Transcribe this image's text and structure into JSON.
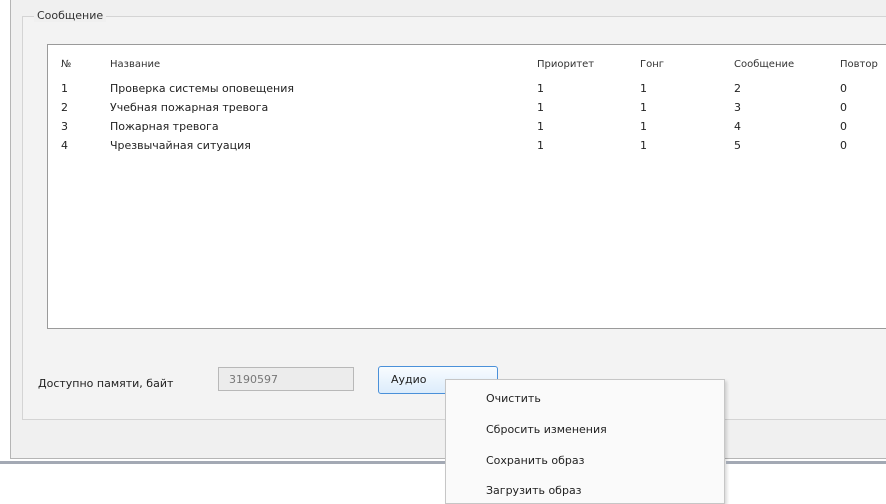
{
  "group": {
    "title": "Сообщение"
  },
  "table": {
    "headers": [
      "№",
      "Название",
      "Приоритет",
      "Гонг",
      "Сообщение",
      "Повтор"
    ],
    "rows": [
      [
        "1",
        "Проверка системы оповещения",
        "1",
        "1",
        "2",
        "0"
      ],
      [
        "2",
        "Учебная пожарная тревога",
        "1",
        "1",
        "3",
        "0"
      ],
      [
        "3",
        "Пожарная тревога",
        "1",
        "1",
        "4",
        "0"
      ],
      [
        "4",
        "Чрезвычайная ситуация",
        "1",
        "1",
        "5",
        "0"
      ]
    ]
  },
  "memory": {
    "label": "Доступно памяти, байт",
    "value": "3190597"
  },
  "audio_button": {
    "label": "Аудио"
  },
  "context_menu": {
    "items": [
      "Очистить",
      "Сбросить изменения",
      "Сохранить образ",
      "Загрузить образ"
    ]
  }
}
